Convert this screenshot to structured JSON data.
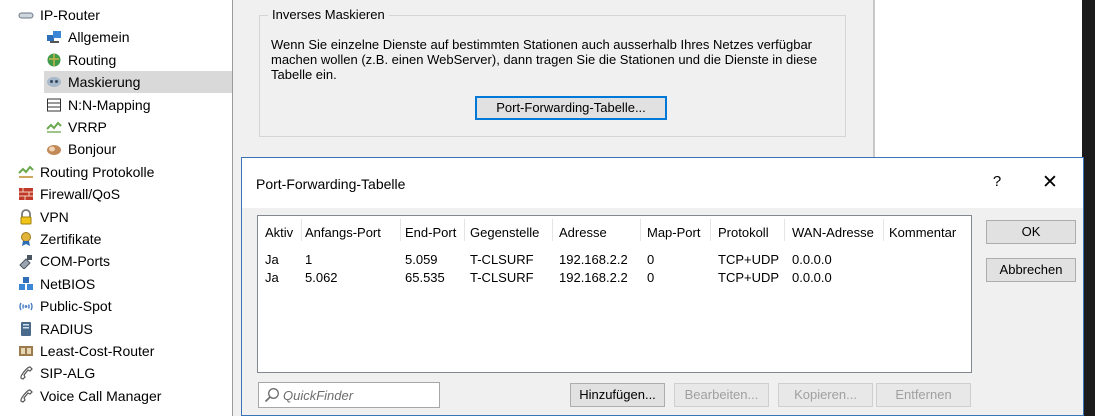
{
  "tree": {
    "items": [
      {
        "label": "IP-Router",
        "icon": "network-cable-icon",
        "level": 0
      },
      {
        "label": "Allgemein",
        "icon": "computers-icon",
        "level": 1
      },
      {
        "label": "Routing",
        "icon": "router-globe-icon",
        "level": 1
      },
      {
        "label": "Maskierung",
        "icon": "mask-icon",
        "level": 1,
        "selected": true
      },
      {
        "label": "N:N-Mapping",
        "icon": "mapping-icon",
        "level": 1
      },
      {
        "label": "VRRP",
        "icon": "vrrp-icon",
        "level": 1
      },
      {
        "label": "Bonjour",
        "icon": "bonjour-icon",
        "level": 1
      },
      {
        "label": "Routing Protokolle",
        "icon": "routing-protocols-icon",
        "level": 0
      },
      {
        "label": "Firewall/QoS",
        "icon": "firewall-icon",
        "level": 0
      },
      {
        "label": "VPN",
        "icon": "lock-icon",
        "level": 0
      },
      {
        "label": "Zertifikate",
        "icon": "certificate-icon",
        "level": 0
      },
      {
        "label": "COM-Ports",
        "icon": "com-port-icon",
        "level": 0
      },
      {
        "label": "NetBIOS",
        "icon": "netbios-icon",
        "level": 0
      },
      {
        "label": "Public-Spot",
        "icon": "wireless-icon",
        "level": 0
      },
      {
        "label": "RADIUS",
        "icon": "server-icon",
        "level": 0
      },
      {
        "label": "Least-Cost-Router",
        "icon": "lcr-icon",
        "level": 0
      },
      {
        "label": "SIP-ALG",
        "icon": "phone-handset-icon",
        "level": 0
      },
      {
        "label": "Voice Call Manager",
        "icon": "voice-icon",
        "level": 0
      }
    ]
  },
  "background": {
    "group_title": "Inverses Maskieren",
    "description": "Wenn Sie einzelne Dienste auf bestimmten Stationen auch ausserhalb Ihres Netzes verfügbar machen wollen (z.B. einen WebServer), dann tragen Sie die Stationen und die Dienste in diese Tabelle ein.",
    "button_label": "Port-Forwarding-Tabelle..."
  },
  "dialog": {
    "title": "Port-Forwarding-Tabelle",
    "help_label": "?",
    "close_label": "✕",
    "columns": [
      "Aktiv",
      "Anfangs-Port",
      "End-Port",
      "Gegenstelle",
      "Adresse",
      "Map-Port",
      "Protokoll",
      "WAN-Adresse",
      "Kommentar"
    ],
    "rows": [
      [
        "Ja",
        "1",
        "5.059",
        "T-CLSURF",
        "192.168.2.2",
        "0",
        "TCP+UDP",
        "0.0.0.0",
        ""
      ],
      [
        "Ja",
        "5.062",
        "65.535",
        "T-CLSURF",
        "192.168.2.2",
        "0",
        "TCP+UDP",
        "0.0.0.0",
        ""
      ]
    ],
    "ok_label": "OK",
    "cancel_label": "Abbrechen",
    "quickfinder_placeholder": "QuickFinder",
    "add_label": "Hinzufügen...",
    "edit_label": "Bearbeiten...",
    "copy_label": "Kopieren...",
    "remove_label": "Entfernen"
  },
  "colors": {
    "selection": "#d9d9d9",
    "dialog_border": "#3a74b8",
    "focus": "#0078d7"
  }
}
